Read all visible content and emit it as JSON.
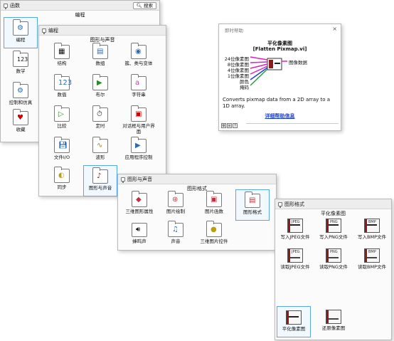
{
  "win1": {
    "title": "函数",
    "search_label": "搜索",
    "subtitle": "编程",
    "sidebar": [
      {
        "label": "编程",
        "icon": "programming-icon"
      },
      {
        "label": "数学",
        "icon": "math-icon"
      },
      {
        "label": "控制和仿真",
        "icon": "control-sim-icon"
      },
      {
        "label": "收藏",
        "icon": "favorites-icon"
      }
    ]
  },
  "win2": {
    "title": "编程",
    "subtitle": "图形与声音",
    "items": [
      {
        "label": "结构"
      },
      {
        "label": "数组"
      },
      {
        "label": "簇、类与变体"
      },
      {
        "label": "数值"
      },
      {
        "label": "布尔"
      },
      {
        "label": "字符串"
      },
      {
        "label": "比较"
      },
      {
        "label": "定时"
      },
      {
        "label": "对话框与用户界面"
      },
      {
        "label": "文件I/O"
      },
      {
        "label": "波形"
      },
      {
        "label": "应用程序控制"
      },
      {
        "label": "同步"
      },
      {
        "label": "图形与声音"
      }
    ]
  },
  "win3": {
    "title": "图形与声音",
    "subtitle": "图形格式",
    "items": [
      {
        "label": "三维图形属性"
      },
      {
        "label": "图片绘制"
      },
      {
        "label": "图片函数"
      },
      {
        "label": "图形格式"
      },
      {
        "label": "蜂鸣声"
      },
      {
        "label": "声音"
      },
      {
        "label": "三维图片控件"
      }
    ]
  },
  "win4": {
    "title": "图形格式",
    "subtitle": "平化像素图",
    "items": [
      {
        "label": "写入JPEG文件",
        "cap": "JPEG"
      },
      {
        "label": "写入PNG文件",
        "cap": "PNG"
      },
      {
        "label": "写入BMP文件",
        "cap": "BMP"
      },
      {
        "label": "读取JPEG文件",
        "cap": "JPEG"
      },
      {
        "label": "读取PNG文件",
        "cap": "PNG"
      },
      {
        "label": "读取BMP文件",
        "cap": "BMP"
      },
      {
        "label": "平化像素图",
        "cap": ""
      },
      {
        "label": "还原像素图",
        "cap": ""
      }
    ]
  },
  "help": {
    "title": "即时帮助",
    "close": "×",
    "name_cn": "平化像素图",
    "name_en": "[Flatten Pixmap.vi]",
    "inputs": [
      "24位像素图",
      "8位像素图",
      "4位像素图",
      "1位像素图",
      "颜色",
      "掩码"
    ],
    "output": "图像数据",
    "description": "Converts pixmap data from a 2D array to a 1D array.",
    "link": "详细帮助信息",
    "tools": [
      "⚙",
      "≡",
      "?"
    ],
    "colors": {
      "pink": "#e020c0",
      "blue": "#2040d0",
      "green": "#20a040"
    }
  }
}
